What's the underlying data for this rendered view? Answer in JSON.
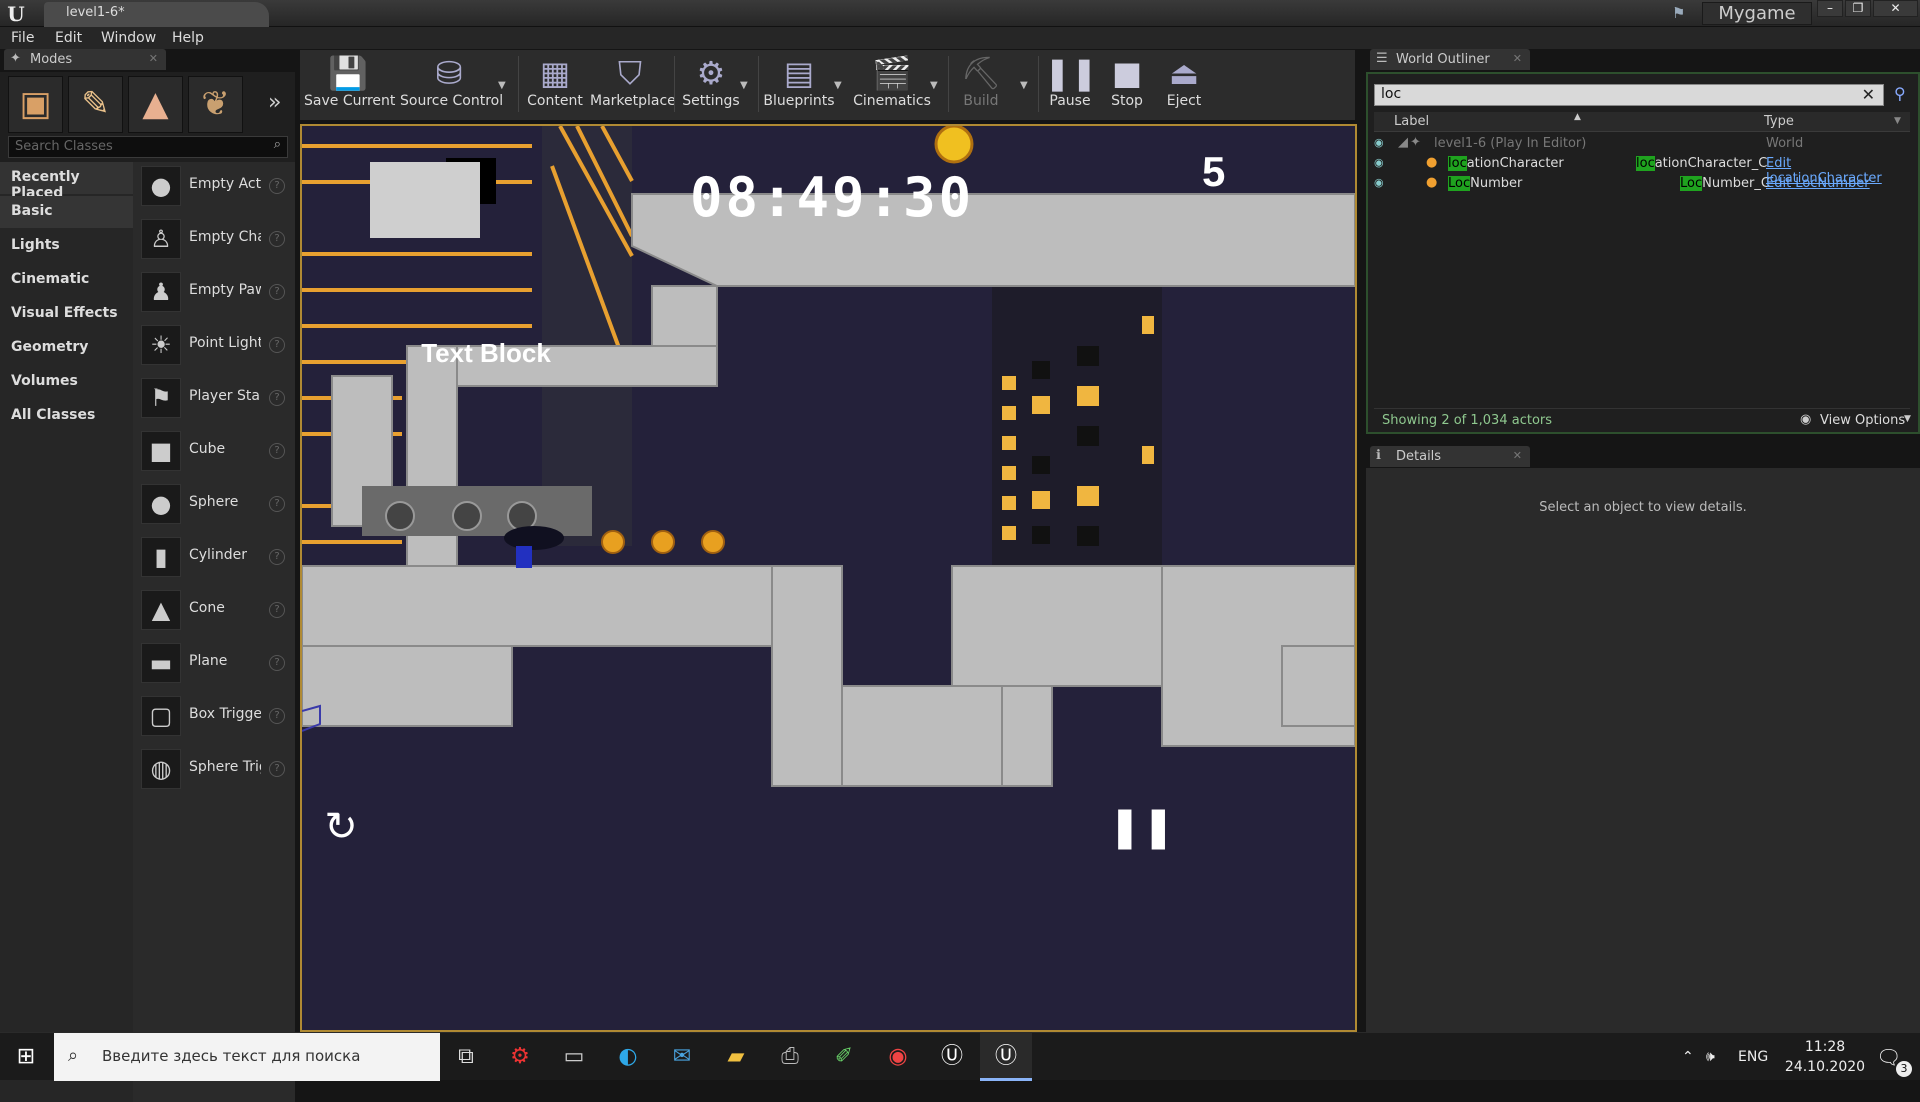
{
  "window": {
    "tab_title": "level1-6*",
    "project_name": "Mygame"
  },
  "menu": [
    "File",
    "Edit",
    "Window",
    "Help"
  ],
  "modes": {
    "tab_label": "Modes",
    "search_placeholder": "Search Classes",
    "categories": [
      "Recently Placed",
      "Basic",
      "Lights",
      "Cinematic",
      "Visual Effects",
      "Geometry",
      "Volumes",
      "All Classes"
    ],
    "selected_category": "Basic",
    "items": [
      "Empty Actor",
      "Empty Character",
      "Empty Pawn",
      "Point Light",
      "Player Start",
      "Cube",
      "Sphere",
      "Cylinder",
      "Cone",
      "Plane",
      "Box Trigger",
      "Sphere Trigger"
    ]
  },
  "toolbar": {
    "buttons": [
      "Save Current",
      "Source Control",
      "Content",
      "Marketplace",
      "Settings",
      "Blueprints",
      "Cinematics",
      "Build",
      "Pause",
      "Stop",
      "Eject"
    ]
  },
  "viewport": {
    "timer": "08:49:30",
    "coin_count": "5",
    "text_block": "Text Block"
  },
  "outliner": {
    "tab_label": "World Outliner",
    "search_value": "loc",
    "columns": [
      "Label",
      "Type"
    ],
    "rows": [
      {
        "label": "level1-6 (Play In Editor)",
        "type": "World",
        "edit": ""
      },
      {
        "label_match": "loc",
        "label_rest": "ationCharacter",
        "type_match": "loc",
        "type_rest": "ationCharacter_C",
        "edit": "Edit locationCharacter"
      },
      {
        "label_match": "Loc",
        "label_rest": "Number",
        "type_match": "Loc",
        "type_rest": "Number_C",
        "edit": "Edit LocNumber"
      }
    ],
    "status": "Showing 2 of 1,034 actors",
    "view_options": "View Options"
  },
  "details": {
    "tab_label": "Details",
    "empty_message": "Select an object to view details."
  },
  "taskbar": {
    "search_placeholder": "Введите здесь текст для поиска",
    "language": "ENG",
    "time": "11:28",
    "date": "24.10.2020",
    "notification_count": "3"
  },
  "colors": {
    "accent_gold": "#b08a33",
    "search_highlight": "#1fa31f",
    "link": "#6aaaff"
  }
}
